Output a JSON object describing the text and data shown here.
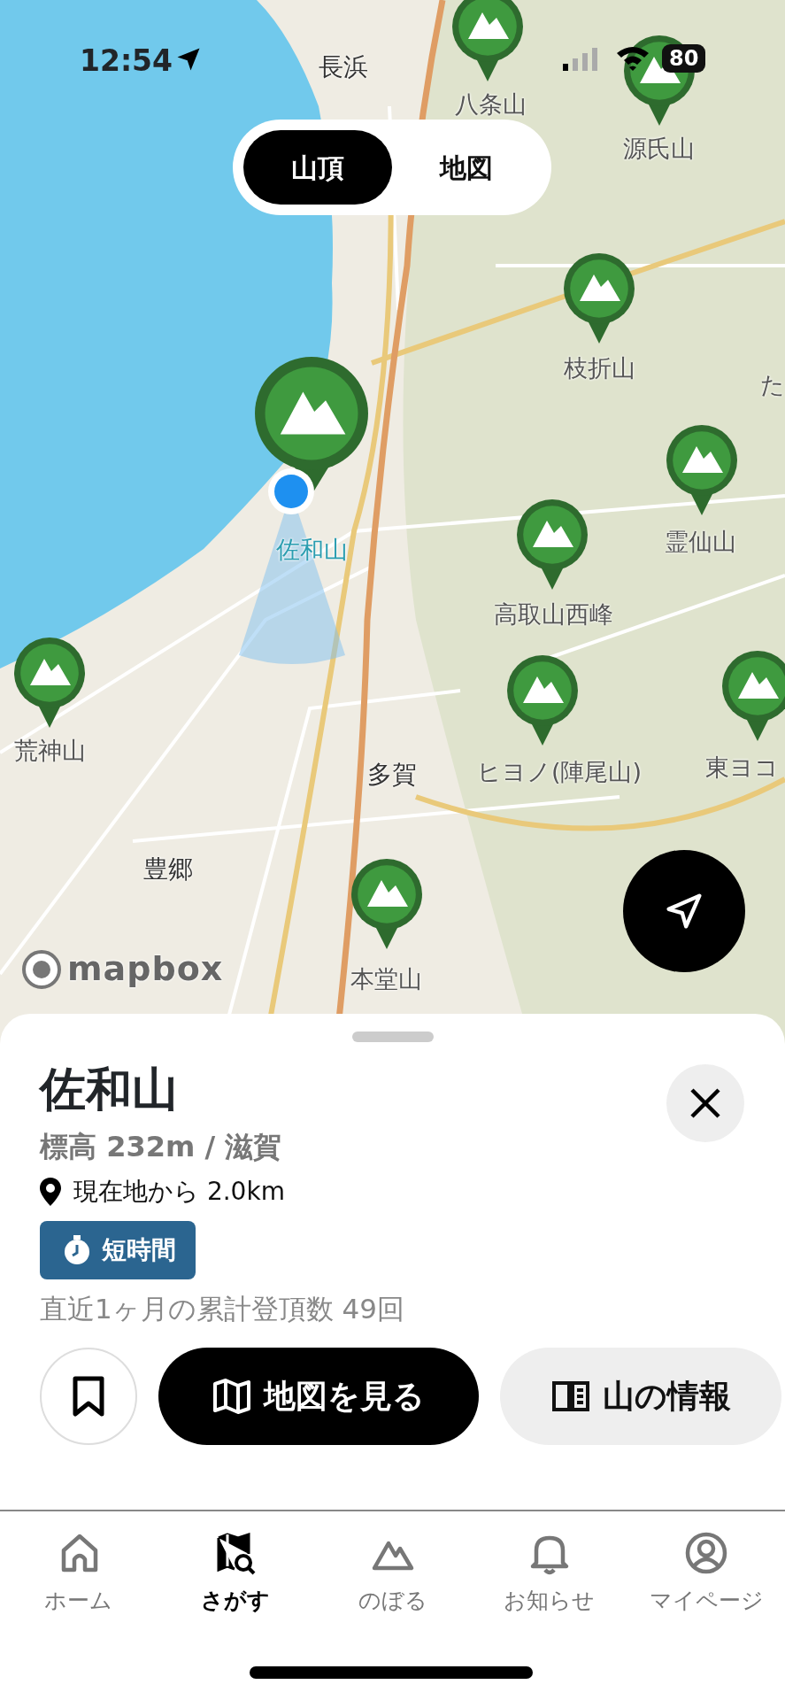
{
  "status_bar": {
    "time": "12:54",
    "battery": "80"
  },
  "view_toggle": [
    {
      "label": "山頂",
      "selected": true
    },
    {
      "label": "地図",
      "selected": false
    }
  ],
  "map": {
    "labels": [
      {
        "text": "長浜",
        "kind": "place"
      },
      {
        "text": "八条山",
        "kind": "peak"
      },
      {
        "text": "源氏山",
        "kind": "peak"
      },
      {
        "text": "枝折山",
        "kind": "peak"
      },
      {
        "text": "た",
        "kind": "peak"
      },
      {
        "text": "佐和山",
        "kind": "current"
      },
      {
        "text": "霊仙山",
        "kind": "peak"
      },
      {
        "text": "高取山西峰",
        "kind": "peak"
      },
      {
        "text": "荒神山",
        "kind": "peak"
      },
      {
        "text": "多賀",
        "kind": "place"
      },
      {
        "text": "ヒヨノ(陣尾山)",
        "kind": "peak"
      },
      {
        "text": "東ヨコ",
        "kind": "peak"
      },
      {
        "text": "豊郷",
        "kind": "place"
      },
      {
        "text": "本堂山",
        "kind": "peak"
      }
    ],
    "pins": [
      {
        "selected": false
      },
      {
        "selected": false
      },
      {
        "selected": false
      },
      {
        "selected": true
      },
      {
        "selected": false
      },
      {
        "selected": false
      },
      {
        "selected": false
      },
      {
        "selected": false
      },
      {
        "selected": false
      },
      {
        "selected": false
      }
    ],
    "attribution": "mapbox"
  },
  "mountain": {
    "name": "佐和山",
    "elevation": "標高 232m / 滋賀",
    "distance": "現在地から 2.0km",
    "tag": "短時間",
    "summit_count": "直近1ヶ月の累計登頂数 49回",
    "bookmarked": false
  },
  "actions": [
    {
      "label": "地図を見る",
      "kind": "primary"
    },
    {
      "label": "山の情報",
      "kind": "secondary"
    }
  ],
  "tab_bar": [
    {
      "label": "ホーム",
      "selected": false
    },
    {
      "label": "さがす",
      "selected": true
    },
    {
      "label": "のぼる",
      "selected": false
    },
    {
      "label": "お知らせ",
      "selected": false
    },
    {
      "label": "マイページ",
      "selected": false
    }
  ]
}
